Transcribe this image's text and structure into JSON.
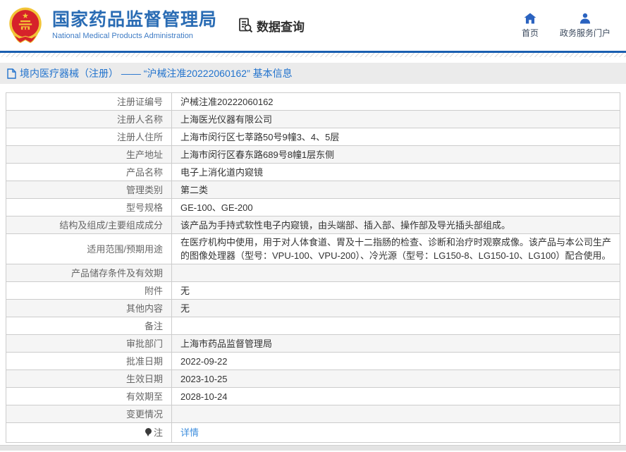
{
  "header": {
    "org_name_zh": "国家药品监督管理局",
    "org_name_en": "National Medical Products Administration",
    "section_title": "数据查询",
    "nav": [
      {
        "label": "首页",
        "icon": "home-icon"
      },
      {
        "label": "政务服务门户",
        "icon": "user-icon"
      }
    ]
  },
  "breadcrumb": {
    "icon": "document-icon",
    "text": "境内医疗器械（注册） —— “沪械注准20222060162” 基本信息"
  },
  "table": {
    "rows": [
      {
        "label": "注册证编号",
        "value": "沪械注准20222060162"
      },
      {
        "label": "注册人名称",
        "value": "上海医光仪器有限公司"
      },
      {
        "label": "注册人住所",
        "value": "上海市闵行区七莘路50号9幢3、4、5层"
      },
      {
        "label": "生产地址",
        "value": "上海市闵行区春东路689号8幢1层东侧"
      },
      {
        "label": "产品名称",
        "value": "电子上消化道内窥镜"
      },
      {
        "label": "管理类别",
        "value": "第二类"
      },
      {
        "label": "型号规格",
        "value": "GE-100、GE-200"
      },
      {
        "label": "结构及组成/主要组成成分",
        "value": "该产品为手持式软性电子内窥镜，由头端部、插入部、操作部及导光插头部组成。"
      },
      {
        "label": "适用范围/预期用途",
        "value": "在医疗机构中使用，用于对人体食道、胃及十二指肠的检查、诊断和治疗时观察成像。该产品与本公司生产的图像处理器（型号：VPU-100、VPU-200）、冷光源（型号：LG150-8、LG150-10、LG100）配合使用。"
      },
      {
        "label": "产品储存条件及有效期",
        "value": ""
      },
      {
        "label": "附件",
        "value": "无"
      },
      {
        "label": "其他内容",
        "value": "无"
      },
      {
        "label": "备注",
        "value": ""
      },
      {
        "label": "审批部门",
        "value": "上海市药品监督管理局"
      },
      {
        "label": "批准日期",
        "value": "2022-09-22"
      },
      {
        "label": "生效日期",
        "value": "2023-10-25"
      },
      {
        "label": "有效期至",
        "value": "2028-10-24"
      },
      {
        "label": "变更情况",
        "value": ""
      },
      {
        "label": "注",
        "icon": "balloon-note-icon",
        "value": "详情",
        "link": true
      }
    ]
  },
  "colors": {
    "brand_blue": "#2a6cb4",
    "header_rule_blue": "#1a5fb0",
    "breadcrumb_blue": "#2273cd",
    "link_blue": "#3e8edd",
    "nav_icon_blue": "#2b63c0",
    "row_alt_bg": "#f5f5f5",
    "table_border": "#cccccc",
    "emblem_red": "#d6222a",
    "emblem_gold": "#f2c437"
  }
}
